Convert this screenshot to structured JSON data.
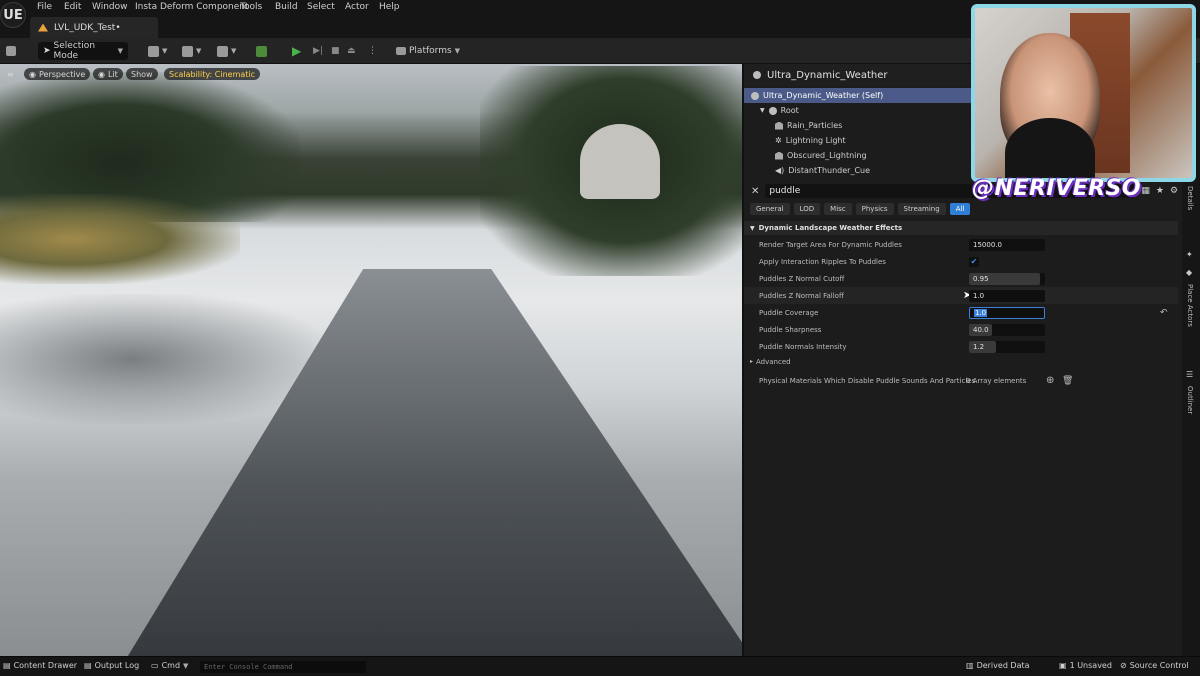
{
  "app": {
    "logo": "UE",
    "level_tab": "LVL_UDK_Test•"
  },
  "menu": [
    "File",
    "Edit",
    "Window",
    "Insta Deform Component",
    "Tools",
    "Build",
    "Select",
    "Actor",
    "Help"
  ],
  "toolbar": {
    "selection_mode": "Selection Mode",
    "platforms": "Platforms"
  },
  "viewport": {
    "perspective": "Perspective",
    "lit": "Lit",
    "show": "Show",
    "scalability": "Scalability: Cinematic"
  },
  "details": {
    "title": "Ultra_Dynamic_Weather",
    "components": [
      {
        "label": "Ultra_Dynamic_Weather (Self)",
        "icon": "actor-icon"
      },
      {
        "label": "Root",
        "icon": "scene-icon"
      },
      {
        "label": "Rain_Particles",
        "icon": "particles-icon"
      },
      {
        "label": "Lightning Light",
        "icon": "light-icon"
      },
      {
        "label": "Obscured_Lightning",
        "icon": "particles-icon"
      },
      {
        "label": "DistantThunder_Cue",
        "icon": "sound-icon"
      }
    ],
    "search_value": "puddle",
    "filter_tabs": [
      "General",
      "LOD",
      "Misc",
      "Physics",
      "Streaming",
      "All"
    ],
    "active_tab": "All",
    "section_title": "Dynamic Landscape Weather Effects",
    "properties": [
      {
        "label": "Render Target Area For Dynamic Puddles",
        "value": "15000.0"
      },
      {
        "label": "Apply Interaction Ripples To Puddles",
        "value": "✔"
      },
      {
        "label": "Puddles Z Normal Cutoff",
        "value": "0.95"
      },
      {
        "label": "Puddles Z Normal Falloff",
        "value": "1.0"
      },
      {
        "label": "Puddle Coverage",
        "value": "1.0"
      },
      {
        "label": "Puddle Sharpness",
        "value": "40.0"
      },
      {
        "label": "Puddle Normals Intensity",
        "value": "1.2"
      }
    ],
    "advanced_label": "Advanced",
    "array_property": {
      "label": "Physical Materials Which Disable Puddle Sounds And Particles",
      "value": "0 Array elements"
    }
  },
  "side_strip": {
    "details": "Details",
    "place_actors": "Place Actors",
    "outliner": "Outliner"
  },
  "overlay": {
    "handle": "@NERIVERSO"
  },
  "statusbar": {
    "content_drawer": "Content Drawer",
    "output_log": "Output Log",
    "cmd": "Cmd",
    "console_placeholder": "Enter Console Command",
    "derived_data": "Derived Data",
    "unsaved": "1 Unsaved",
    "source_control": "Source Control"
  },
  "colors": {
    "accent": "#2f7fd6",
    "selection": "#4b5a88",
    "scalability": "#ffd04a",
    "webcam_border": "#8ed7e6",
    "handle_shadow": "#6b2fbf"
  }
}
